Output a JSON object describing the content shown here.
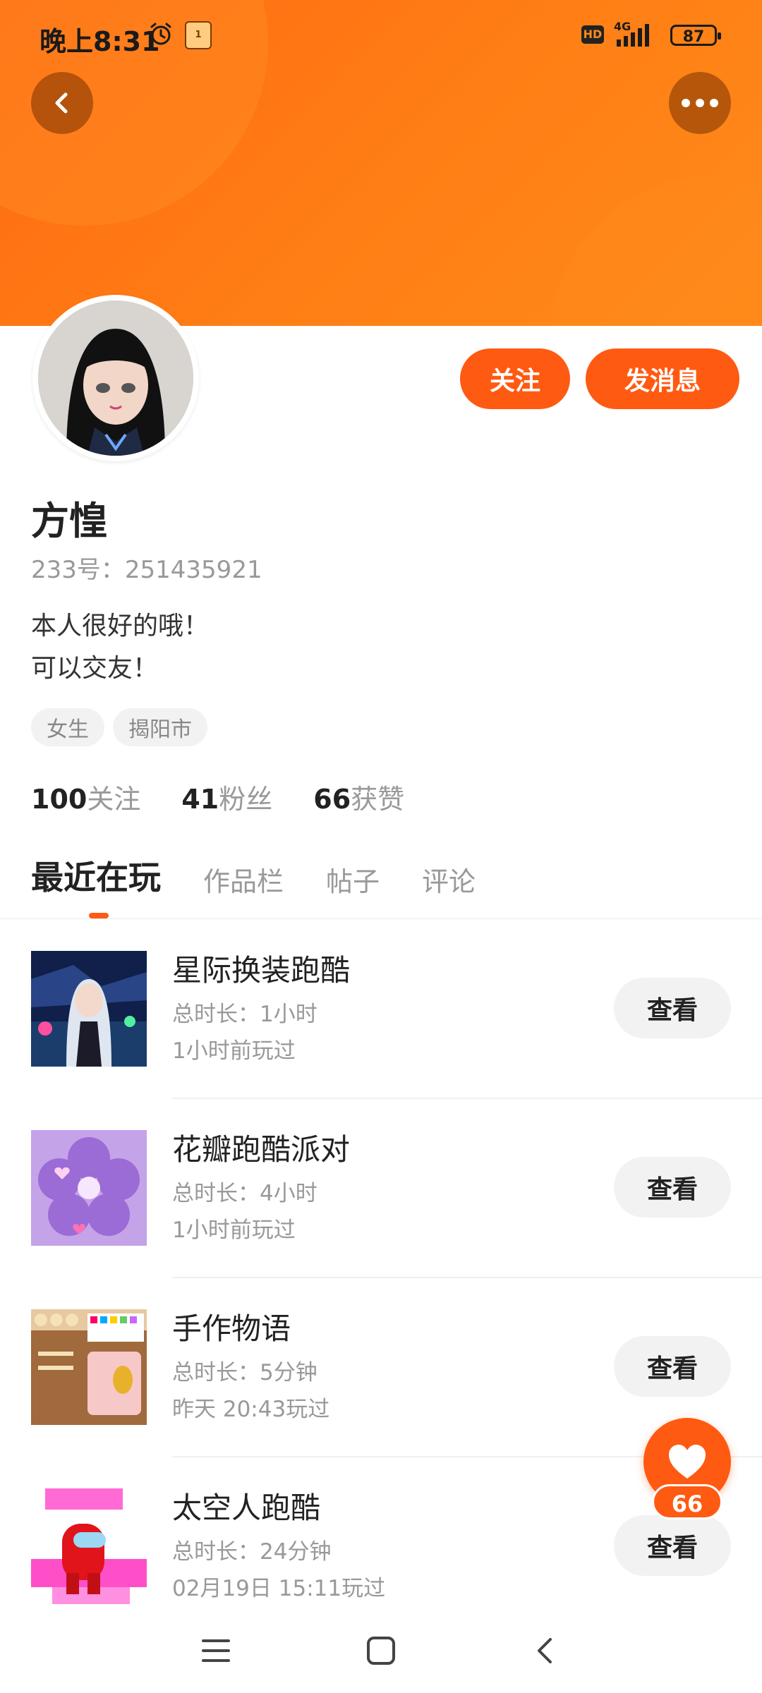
{
  "status_bar": {
    "time": "晚上8:31",
    "network": "4G",
    "battery": "87",
    "hd_badge": "HD",
    "app_badge": "1"
  },
  "header": {
    "accent_color": "#ff6a13"
  },
  "profile": {
    "name": "方惶",
    "id_text": "233号：251435921",
    "bio_lines": [
      "本人很好的哦！",
      "可以交友！"
    ],
    "tags": [
      "女生",
      "揭阳市"
    ],
    "stats": [
      {
        "num": "100",
        "label": "关注"
      },
      {
        "num": "41",
        "label": "粉丝"
      },
      {
        "num": "66",
        "label": "获赞"
      }
    ]
  },
  "actions": {
    "follow_label": "关注",
    "message_label": "发消息"
  },
  "tabs": [
    {
      "label": "最近在玩",
      "active": true
    },
    {
      "label": "作品栏",
      "active": false
    },
    {
      "label": "帖子",
      "active": false
    },
    {
      "label": "评论",
      "active": false
    }
  ],
  "games": [
    {
      "name": "星际换装跑酷",
      "duration": "总时长：1小时",
      "played": "1小时前玩过",
      "button": "查看",
      "thumb_icon": "anime-character-thumb"
    },
    {
      "name": "花瓣跑酷派对",
      "duration": "总时长：4小时",
      "played": "1小时前玩过",
      "button": "查看",
      "thumb_icon": "flower-petal-thumb"
    },
    {
      "name": "手作物语",
      "duration": "总时长：5分钟",
      "played": "昨天 20:43玩过",
      "button": "查看",
      "thumb_icon": "craft-table-thumb"
    },
    {
      "name": "太空人跑酷",
      "duration": "总时长：24分钟",
      "played": "02月19日 15:11玩过",
      "button": "查看",
      "thumb_icon": "space-runner-thumb"
    }
  ],
  "like_fab": {
    "count": "66"
  }
}
